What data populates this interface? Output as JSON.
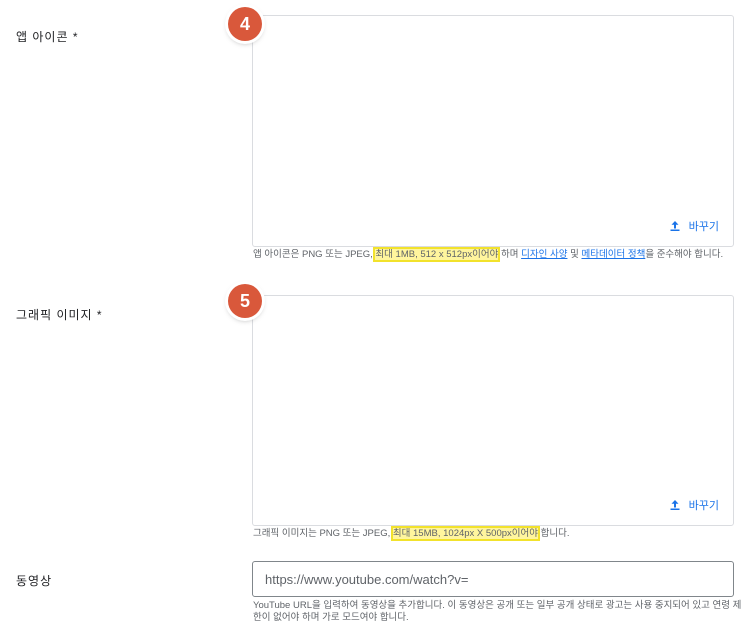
{
  "app_icon": {
    "label": "앱 아이콘 *",
    "badge": "4",
    "replace_label": "바꾸기",
    "help_prefix": "앱 아이콘은 PNG 또는 JPEG, ",
    "help_highlight": "최대 1MB, 512 x 512px이어야",
    "help_mid": " 하며 ",
    "link_design": "디자인 사양",
    "help_and": " 및 ",
    "link_metadata": "메타데이터 정책",
    "help_suffix": "을 준수해야 합니다."
  },
  "graphic_image": {
    "label": "그래픽 이미지 *",
    "badge": "5",
    "replace_label": "바꾸기",
    "help_prefix": "그래픽 이미지는 PNG 또는 JPEG, ",
    "help_highlight": "최대 15MB, 1024px X 500px이어야",
    "help_suffix": " 합니다."
  },
  "video": {
    "label": "동영상",
    "placeholder": "https://www.youtube.com/watch?v=",
    "help": "YouTube URL을 입력하여 동영상을 추가합니다. 이 동영상은 공개 또는 일부 공개 상태로 광고는 사용 중지되어 있고 연령 제한이 없어야 하며 가로 모드여야 합니다."
  },
  "colors": {
    "accent": "#1a73e8",
    "badge": "#d9583b",
    "highlight": "#fff59d"
  }
}
